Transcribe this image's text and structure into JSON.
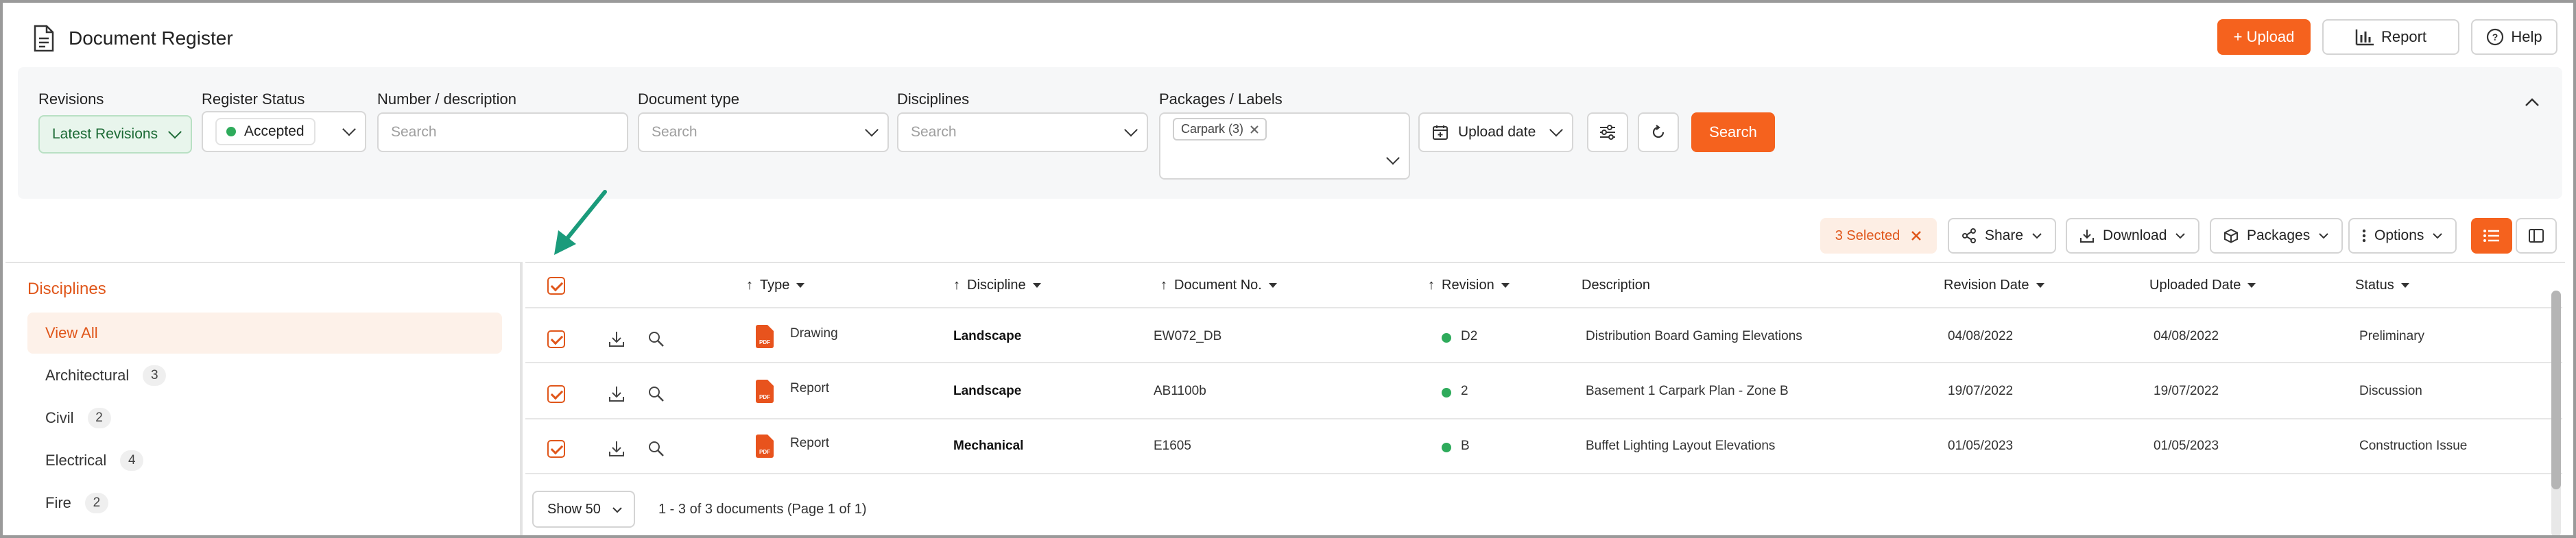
{
  "header": {
    "title": "Document Register",
    "upload_label": "+ Upload",
    "report_label": "Report",
    "help_label": "Help"
  },
  "filters": {
    "revisions": {
      "label": "Revisions",
      "value": "Latest Revisions"
    },
    "register_status": {
      "label": "Register Status",
      "value": "Accepted"
    },
    "number_description": {
      "label": "Number / description",
      "placeholder": "Search"
    },
    "document_type": {
      "label": "Document type",
      "placeholder": "Search"
    },
    "disciplines": {
      "label": "Disciplines",
      "placeholder": "Search"
    },
    "packages": {
      "label": "Packages / Labels",
      "tag": "Carpark (3)"
    },
    "upload_date_label": "Upload date",
    "search_label": "Search"
  },
  "toolbar": {
    "selected_label": "3 Selected",
    "share_label": "Share",
    "download_label": "Download",
    "packages_label": "Packages",
    "options_label": "Options"
  },
  "sidebar": {
    "title": "Disciplines",
    "items": [
      {
        "label": "View All",
        "count": ""
      },
      {
        "label": "Architectural",
        "count": "3"
      },
      {
        "label": "Civil",
        "count": "2"
      },
      {
        "label": "Electrical",
        "count": "4"
      },
      {
        "label": "Fire",
        "count": "2"
      }
    ]
  },
  "table": {
    "columns": {
      "type": "Type",
      "discipline": "Discipline",
      "document_no": "Document No.",
      "revision": "Revision",
      "description": "Description",
      "revision_date": "Revision Date",
      "uploaded_date": "Uploaded Date",
      "status": "Status"
    },
    "rows": [
      {
        "type": "Drawing",
        "discipline": "Landscape",
        "document_no": "EW072_DB",
        "revision": "D2",
        "description": "Distribution Board Gaming Elevations",
        "revision_date": "04/08/2022",
        "uploaded_date": "04/08/2022",
        "status": "Preliminary"
      },
      {
        "type": "Report",
        "discipline": "Landscape",
        "document_no": "AB1100b",
        "revision": "2",
        "description": "Basement 1 Carpark Plan - Zone B",
        "revision_date": "19/07/2022",
        "uploaded_date": "19/07/2022",
        "status": "Discussion"
      },
      {
        "type": "Report",
        "discipline": "Mechanical",
        "document_no": "E1605",
        "revision": "B",
        "description": "Buffet Lighting Layout Elevations",
        "revision_date": "01/05/2023",
        "uploaded_date": "01/05/2023",
        "status": "Construction Issue"
      }
    ],
    "show_label": "Show 50",
    "pager_text": "1 - 3 of 3 documents (Page 1 of 1)"
  },
  "colors": {
    "accent": "#f5621e",
    "status_green": "#2eab5b",
    "annotation_arrow": "#1a9b7b"
  }
}
